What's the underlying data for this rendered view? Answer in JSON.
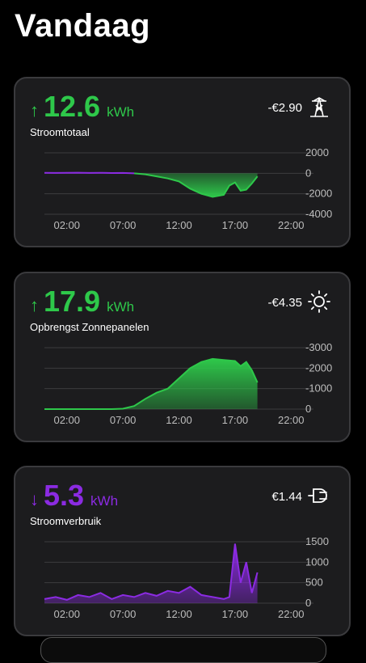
{
  "page": {
    "title": "Vandaag"
  },
  "cards": [
    {
      "id": "grid",
      "direction": "up",
      "arrow": "↑",
      "value": "12.6",
      "unit": "kWh",
      "label": "Stroomtotaal",
      "cost": "-€2.90",
      "icon": "power-pylon-icon",
      "accent": "#2ec84a"
    },
    {
      "id": "solar",
      "direction": "up",
      "arrow": "↑",
      "value": "17.9",
      "unit": "kWh",
      "label": "Opbrengst Zonnepanelen",
      "cost": "-€4.35",
      "icon": "sun-icon",
      "accent": "#2ec84a"
    },
    {
      "id": "consumption",
      "direction": "down",
      "arrow": "↓",
      "value": "5.3",
      "unit": "kWh",
      "label": "Stroomverbruik",
      "cost": "€1.44",
      "icon": "plug-icon",
      "accent": "#8b2be2"
    }
  ],
  "chart_data": [
    {
      "type": "area",
      "x": [
        "00:00",
        "01:00",
        "02:00",
        "03:00",
        "04:00",
        "05:00",
        "06:00",
        "07:00",
        "07:30",
        "08:00",
        "09:00",
        "10:00",
        "11:00",
        "12:00",
        "13:00",
        "14:00",
        "15:00",
        "16:00",
        "16:30",
        "17:00",
        "17:30",
        "18:00",
        "18:30",
        "19:00"
      ],
      "values": [
        50,
        40,
        50,
        60,
        40,
        50,
        30,
        40,
        20,
        0,
        -100,
        -300,
        -500,
        -800,
        -1500,
        -2000,
        -2300,
        -2100,
        -1200,
        -900,
        -1700,
        -1600,
        -1000,
        -300
      ],
      "xticks": [
        "02:00",
        "07:00",
        "12:00",
        "17:00",
        "22:00"
      ],
      "yticks": [
        "2000",
        "0",
        "-2000",
        "-4000"
      ],
      "ylim": [
        -4000,
        2000
      ],
      "colors": {
        "positive": "#8b2be2",
        "negative": "#2ec84a"
      }
    },
    {
      "type": "area",
      "x": [
        "00:00",
        "01:00",
        "02:00",
        "03:00",
        "04:00",
        "05:00",
        "06:00",
        "07:00",
        "08:00",
        "09:00",
        "10:00",
        "11:00",
        "12:00",
        "13:00",
        "14:00",
        "15:00",
        "16:00",
        "17:00",
        "17:30",
        "18:00",
        "18:30",
        "19:00"
      ],
      "values": [
        0,
        0,
        0,
        0,
        0,
        0,
        0,
        20,
        150,
        500,
        800,
        1000,
        1500,
        2000,
        2300,
        2450,
        2400,
        2350,
        2100,
        2300,
        1900,
        1300
      ],
      "xticks": [
        "02:00",
        "07:00",
        "12:00",
        "17:00",
        "22:00"
      ],
      "yticks": [
        "-3000",
        "-2000",
        "-1000",
        "0"
      ],
      "ylim": [
        0,
        3000
      ],
      "colors": {
        "fill": "#2ec84a"
      }
    },
    {
      "type": "area",
      "x": [
        "00:00",
        "01:00",
        "02:00",
        "03:00",
        "04:00",
        "05:00",
        "06:00",
        "07:00",
        "08:00",
        "09:00",
        "10:00",
        "11:00",
        "12:00",
        "13:00",
        "14:00",
        "15:00",
        "16:00",
        "16:30",
        "17:00",
        "17:30",
        "18:00",
        "18:30",
        "19:00"
      ],
      "values": [
        100,
        150,
        80,
        200,
        150,
        250,
        100,
        200,
        150,
        250,
        180,
        300,
        250,
        400,
        200,
        150,
        100,
        150,
        1450,
        500,
        1000,
        250,
        750
      ],
      "xticks": [
        "02:00",
        "07:00",
        "12:00",
        "17:00",
        "22:00"
      ],
      "yticks": [
        "1500",
        "1000",
        "500",
        "0"
      ],
      "ylim": [
        0,
        1500
      ],
      "colors": {
        "fill": "#8b2be2"
      }
    }
  ]
}
